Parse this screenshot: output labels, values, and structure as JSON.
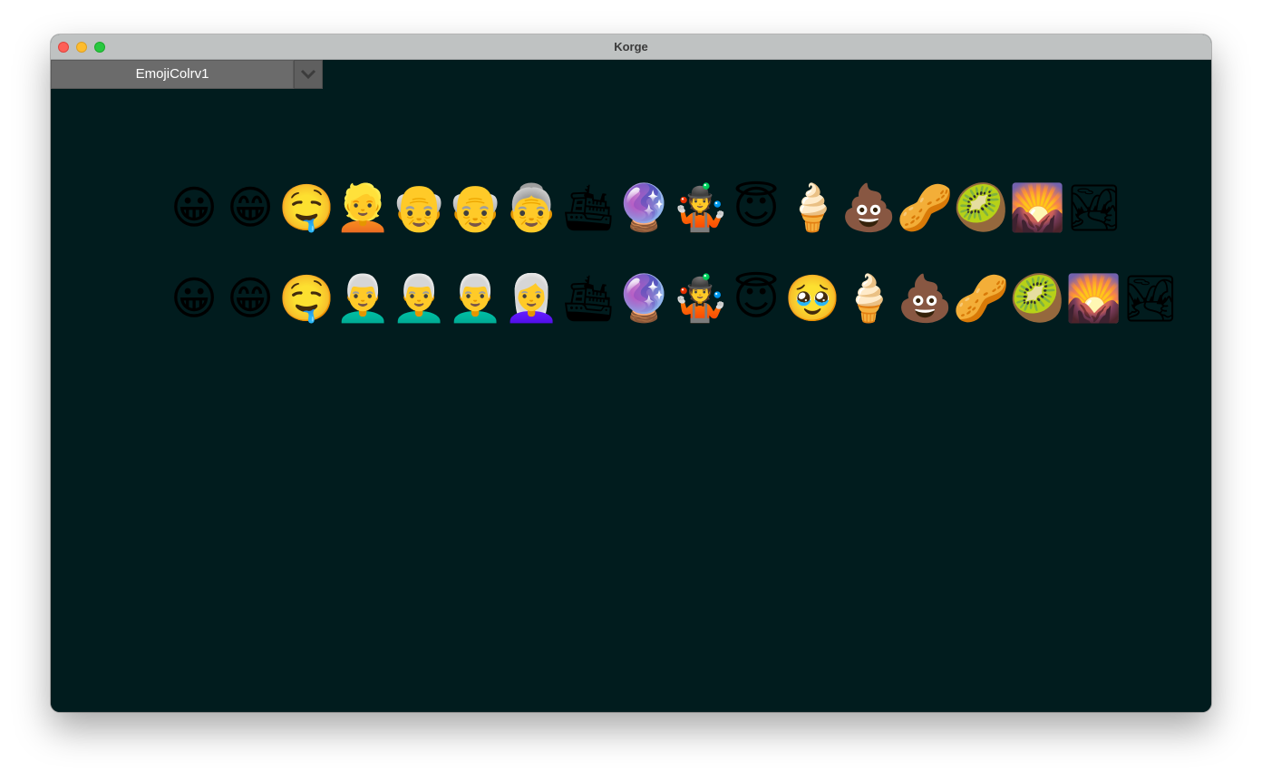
{
  "window": {
    "title": "Korge"
  },
  "dropdown": {
    "selected": "EmojiColrv1"
  },
  "emoji_rows": [
    [
      "😀",
      "😁",
      "🤤",
      "👱",
      "👴",
      "👴",
      "👵",
      "🛳",
      "🔮",
      "🤹",
      "😇",
      "🍦",
      "💩",
      "🥜",
      "🥝",
      "🌄",
      "🏞"
    ],
    [
      "😀",
      "😁",
      "🤤",
      "👨‍🦳",
      "👨‍🦳",
      "👨‍🦳",
      "👩‍🦳",
      "🛳",
      "🔮",
      "🤹",
      "😇",
      "🥹",
      "🍦",
      "💩",
      "🥜",
      "🥝",
      "🌄",
      "🏞"
    ]
  ]
}
